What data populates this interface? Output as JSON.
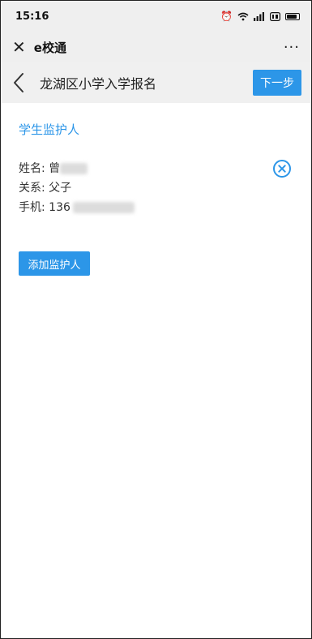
{
  "status": {
    "time": "15:16"
  },
  "app": {
    "title": "e校通",
    "more": "···"
  },
  "header": {
    "title": "龙湖区小学入学报名",
    "next_label": "下一步"
  },
  "section": {
    "title": "学生监护人"
  },
  "guardian": {
    "name_label": "姓名:",
    "name_value": "曾",
    "relation_label": "关系:",
    "relation_value": "父子",
    "phone_label": "手机:",
    "phone_value": "136"
  },
  "actions": {
    "add_label": "添加监护人"
  },
  "colors": {
    "accent": "#2c96e8",
    "header_bg": "#efefef"
  }
}
